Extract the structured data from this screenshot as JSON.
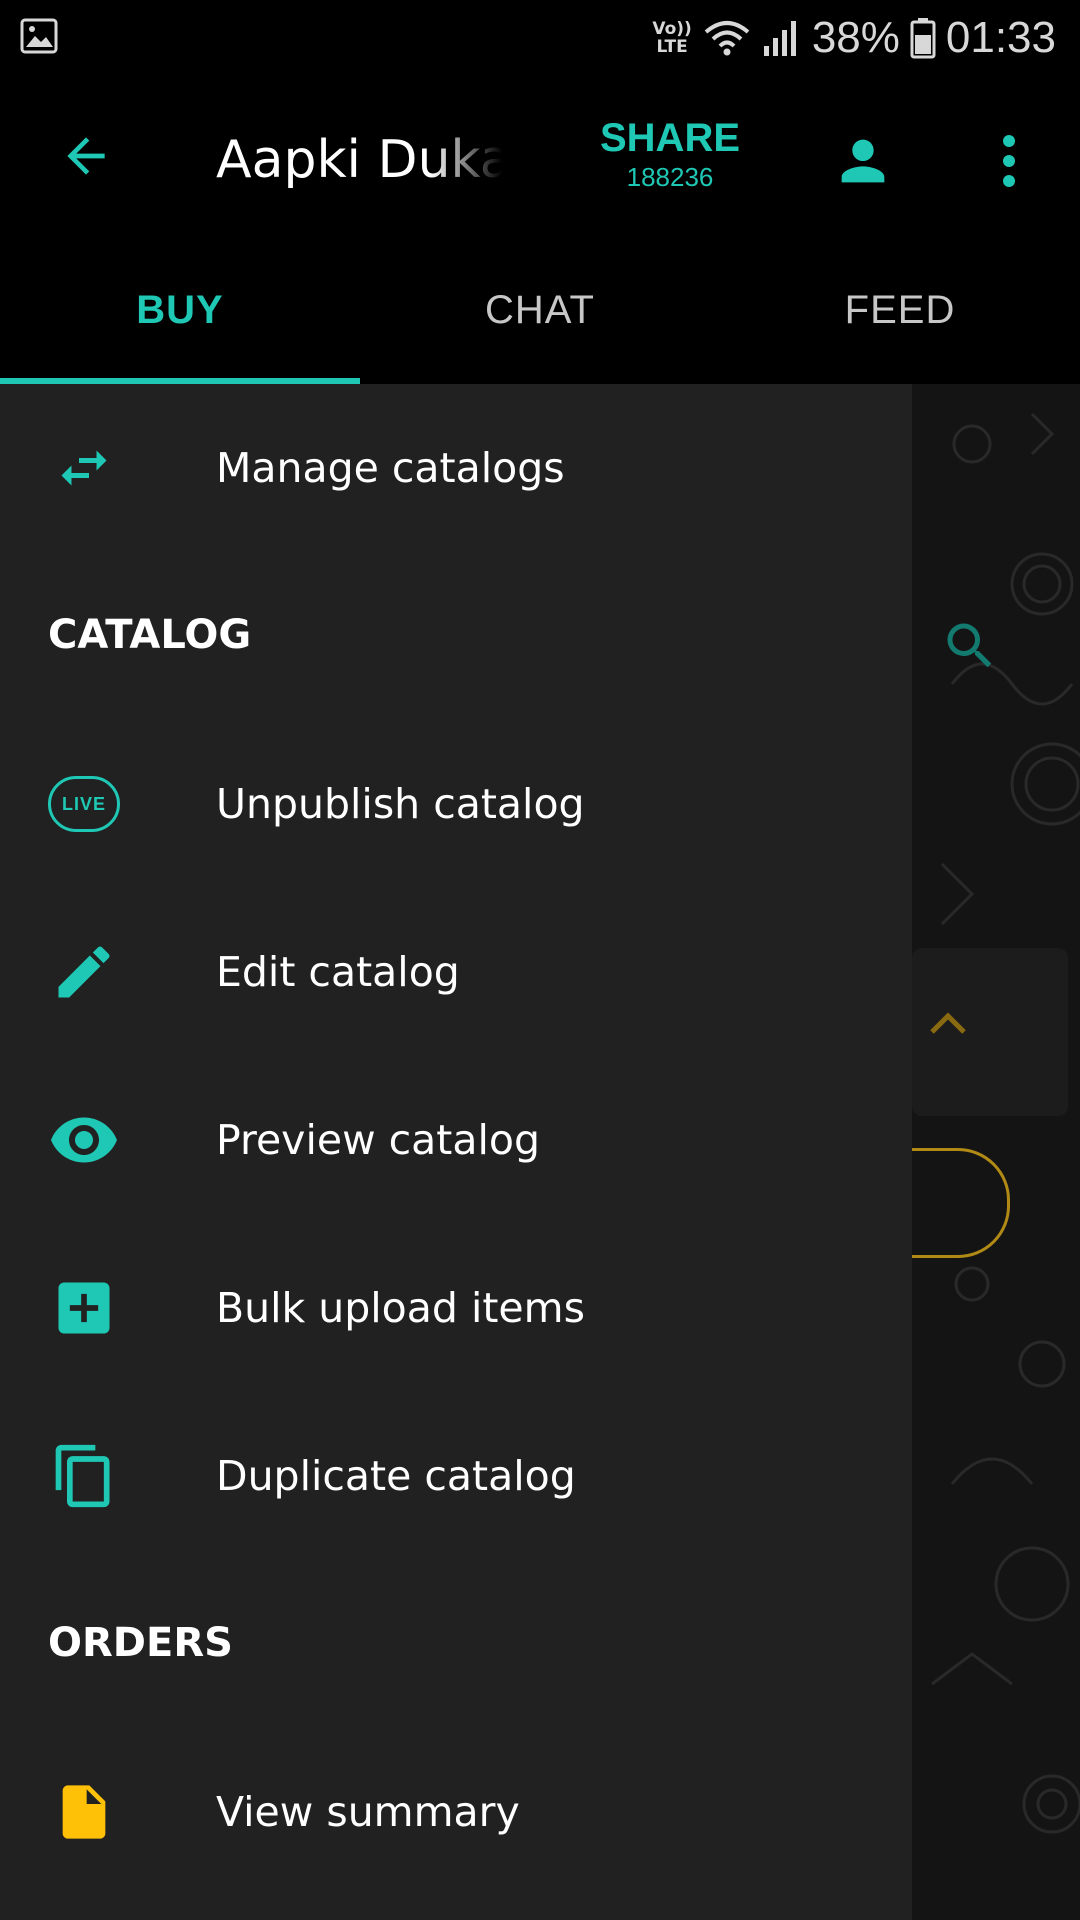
{
  "status_bar": {
    "volte_line1": "Vo))",
    "volte_line2": "LTE",
    "battery": "38%",
    "time": "01:33",
    "icons": [
      "gallery-icon",
      "wifi-icon",
      "signal-icon",
      "battery-icon"
    ]
  },
  "app_bar": {
    "title": "Aapki Dukaan",
    "share_label": "SHARE",
    "share_count": "188236",
    "icons": [
      "back-arrow-icon",
      "person-icon",
      "more-vert-icon"
    ]
  },
  "tabs": [
    {
      "label": "BUY",
      "active": true
    },
    {
      "label": "CHAT",
      "active": false
    },
    {
      "label": "FEED",
      "active": false
    }
  ],
  "drawer": {
    "manage": {
      "label": "Manage catalogs",
      "icon": "swap-arrows-icon"
    },
    "catalog_section": "CATALOG",
    "catalog_items": [
      {
        "label": "Unpublish catalog",
        "icon": "live-badge-icon",
        "badge": "LIVE"
      },
      {
        "label": "Edit catalog",
        "icon": "pencil-icon"
      },
      {
        "label": "Preview catalog",
        "icon": "eye-icon"
      },
      {
        "label": "Bulk upload items",
        "icon": "add-box-icon"
      },
      {
        "label": "Duplicate catalog",
        "icon": "copy-icon"
      }
    ],
    "orders_section": "ORDERS",
    "orders_items": [
      {
        "label": "View summary",
        "icon": "document-icon"
      }
    ]
  },
  "colors": {
    "accent": "#1ec8b4",
    "drawer_bg": "#212121",
    "document_icon": "#ffc107",
    "background_accent": "#b18a16"
  }
}
